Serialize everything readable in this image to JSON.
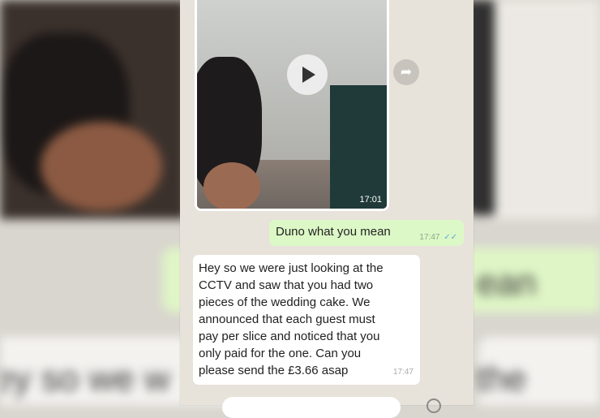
{
  "video_message": {
    "time": "17:01"
  },
  "outgoing_message": {
    "text": "Duno what you mean",
    "time": "17:47",
    "ticks": "✓✓"
  },
  "incoming_message": {
    "lines": [
      "Hey so we were just looking at the",
      "CCTV and saw that you had two",
      "pieces of the wedding cake. We",
      "announced that each guest must",
      "pay per slice and noticed that you",
      "only paid for the one. Can you",
      "please send the £3.66 asap"
    ],
    "time": "17:47"
  },
  "background_text": {
    "left": "ey so we w",
    "right": "the",
    "green": "ean"
  },
  "icons": {
    "play": "play-icon",
    "forward": "forward-icon"
  }
}
